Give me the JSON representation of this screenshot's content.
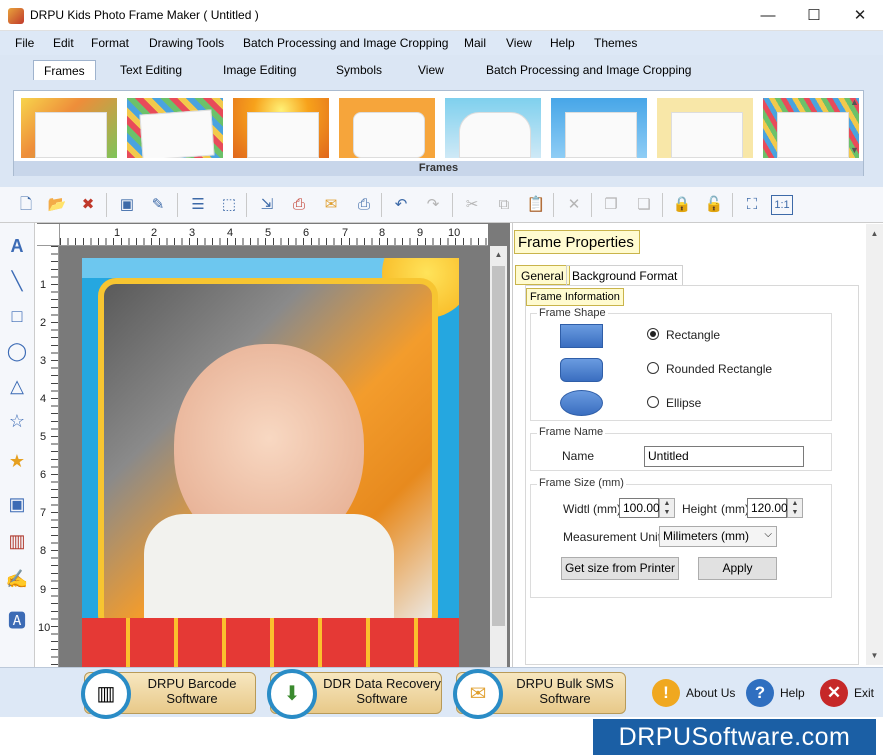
{
  "window": {
    "title": "DRPU Kids Photo Frame Maker ( Untitled )",
    "minimize": "—",
    "maximize": "☐",
    "close": "✕"
  },
  "menu": [
    "File",
    "Edit",
    "Format",
    "Drawing Tools",
    "Batch Processing and Image Cropping",
    "Mail",
    "View",
    "Help",
    "Themes"
  ],
  "ribbon": {
    "tabs": [
      "Frames",
      "Text Editing",
      "Image Editing",
      "Symbols",
      "View",
      "Batch Processing and Image Cropping"
    ],
    "gallery_label": "Frames"
  },
  "ruler": {
    "horizontal": [
      "1",
      "2",
      "3",
      "4",
      "5",
      "6",
      "7",
      "8",
      "9",
      "10"
    ],
    "vertical": [
      "1",
      "2",
      "3",
      "4",
      "5",
      "6",
      "7",
      "8",
      "9",
      "10"
    ]
  },
  "props": {
    "header": "Frame Properties",
    "tabs": [
      "General",
      "Background Format"
    ],
    "frame_info_label": "Frame Information",
    "frame_shape": {
      "label": "Frame Shape",
      "options": [
        "Rectangle",
        "Rounded Rectangle",
        "Ellipse"
      ],
      "selected": "Rectangle"
    },
    "frame_name": {
      "label": "Frame Name",
      "name_label": "Name",
      "value": "Untitled"
    },
    "frame_size": {
      "label": "Frame Size (mm)",
      "width_label": "Widtl (mm)",
      "width_value": "100.00",
      "height_label": "Height",
      "height_unit": "(mm)",
      "height_value": "120.00",
      "unit_label": "Measurement Unit :",
      "unit_value": "Milimeters (mm)",
      "printer_button": "Get size from Printer",
      "apply_button": "Apply"
    }
  },
  "bottom": {
    "promos": [
      "DRPU Barcode\nSoftware",
      "DDR Data Recovery\nSoftware",
      "DRPU Bulk SMS\nSoftware"
    ],
    "about": "About Us",
    "help": "Help",
    "exit": "Exit"
  },
  "brand": "DRPUSoftware.com",
  "colors": {
    "accent": "#1b5fa5",
    "ribbon": "#dbe6f4",
    "header_bg": "#fffbd0"
  }
}
